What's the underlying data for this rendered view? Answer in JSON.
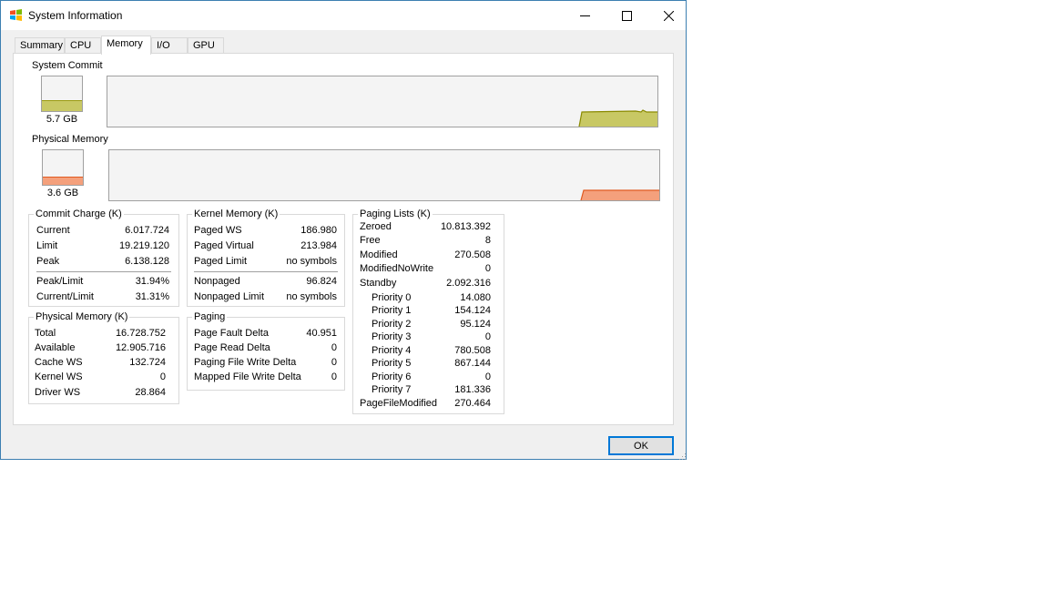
{
  "window": {
    "title": "System Information"
  },
  "tabs": [
    {
      "label": "Summary"
    },
    {
      "label": "CPU"
    },
    {
      "label": "Memory"
    },
    {
      "label": "I/O"
    },
    {
      "label": "GPU"
    }
  ],
  "active_tab": "Memory",
  "system_commit": {
    "label": "System Commit",
    "value": "5.7 GB",
    "color": "#c8c864",
    "line_color": "#9a9a10",
    "level": 0.3
  },
  "physical_memory_graph": {
    "label": "Physical Memory",
    "value": "3.6 GB",
    "color": "#f4a07c",
    "line_color": "#e05a20",
    "level": 0.22
  },
  "commit_charge": {
    "title": "Commit Charge (K)",
    "rows": [
      {
        "k": "Current",
        "v": "6.017.724"
      },
      {
        "k": "Limit",
        "v": "19.219.120"
      },
      {
        "k": "Peak",
        "v": "6.138.128"
      }
    ],
    "rows2": [
      {
        "k": "Peak/Limit",
        "v": "31.94%"
      },
      {
        "k": "Current/Limit",
        "v": "31.31%"
      }
    ]
  },
  "physical_memory": {
    "title": "Physical Memory (K)",
    "rows": [
      {
        "k": "Total",
        "v": "16.728.752"
      },
      {
        "k": "Available",
        "v": "12.905.716"
      },
      {
        "k": "Cache WS",
        "v": "132.724"
      },
      {
        "k": "Kernel WS",
        "v": "0"
      },
      {
        "k": "Driver WS",
        "v": "28.864"
      }
    ]
  },
  "kernel_memory": {
    "title": "Kernel Memory (K)",
    "rows": [
      {
        "k": "Paged WS",
        "v": "186.980"
      },
      {
        "k": "Paged Virtual",
        "v": "213.984"
      },
      {
        "k": "Paged Limit",
        "v": "no symbols"
      }
    ],
    "rows2": [
      {
        "k": "Nonpaged",
        "v": "96.824"
      },
      {
        "k": "Nonpaged Limit",
        "v": "no symbols"
      }
    ]
  },
  "paging": {
    "title": "Paging",
    "rows": [
      {
        "k": "Page Fault Delta",
        "v": "40.951"
      },
      {
        "k": "Page Read Delta",
        "v": "0"
      },
      {
        "k": "Paging File Write Delta",
        "v": "0"
      },
      {
        "k": "Mapped File Write Delta",
        "v": "0"
      }
    ]
  },
  "paging_lists": {
    "title": "Paging Lists (K)",
    "rows": [
      {
        "k": "Zeroed",
        "v": "10.813.392"
      },
      {
        "k": "Free",
        "v": "8"
      },
      {
        "k": "Modified",
        "v": "270.508"
      },
      {
        "k": "ModifiedNoWrite",
        "v": "0"
      },
      {
        "k": "Standby",
        "v": "2.092.316"
      }
    ],
    "priorities": [
      {
        "k": "Priority 0",
        "v": "14.080"
      },
      {
        "k": "Priority 1",
        "v": "154.124"
      },
      {
        "k": "Priority 2",
        "v": "95.124"
      },
      {
        "k": "Priority 3",
        "v": "0"
      },
      {
        "k": "Priority 4",
        "v": "780.508"
      },
      {
        "k": "Priority 5",
        "v": "867.144"
      },
      {
        "k": "Priority 6",
        "v": "0"
      },
      {
        "k": "Priority 7",
        "v": "181.336"
      }
    ],
    "footer": {
      "k": "PageFileModified",
      "v": "270.464"
    }
  },
  "buttons": {
    "ok": "OK"
  },
  "icons": {
    "app": "windows-logo-icon",
    "minimize": "minimize-icon",
    "maximize": "maximize-icon",
    "close": "close-icon"
  }
}
